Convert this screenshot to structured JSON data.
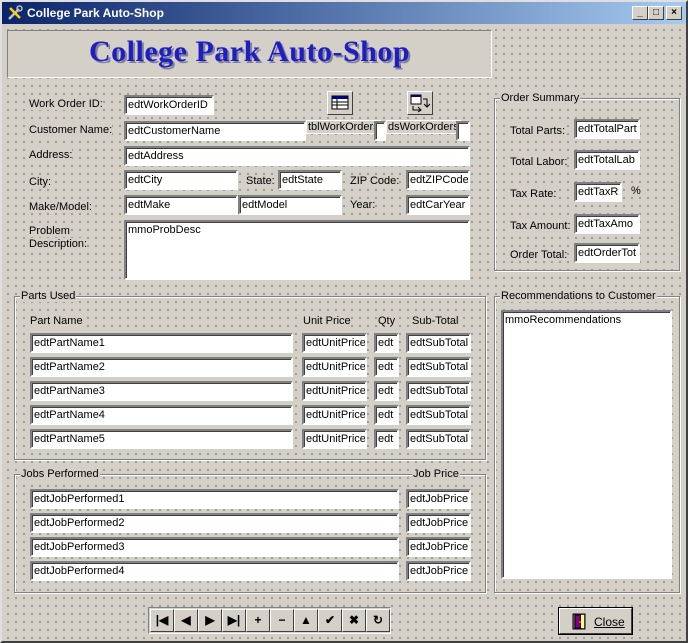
{
  "window": {
    "title": "College Park Auto-Shop",
    "min": "_",
    "max": "□",
    "close": "×"
  },
  "banner": {
    "title": "College Park Auto-Shop"
  },
  "labels": {
    "work_order_id": "Work Order ID:",
    "customer_name": "Customer Name:",
    "address": "Address:",
    "city": "City:",
    "state": "State:",
    "zip": "ZIP Code:",
    "make_model": "Make/Model:",
    "year": "Year:",
    "problem1": "Problem",
    "problem2": "Description:"
  },
  "fields": {
    "work_order_id": "edtWorkOrderID",
    "customer_name": "edtCustomerName",
    "address": "edtAddress",
    "city": "edtCity",
    "state": "edtState",
    "zip": "edtZIPCode",
    "make": "edtMake",
    "model": "edtModel",
    "year": "edtCarYear",
    "problem": "mmoProbDesc"
  },
  "components": {
    "table": "tblWorkOrders",
    "datasource": "dsWorkOrders"
  },
  "order_summary": {
    "caption": "Order Summary",
    "total_parts_label": "Total Parts:",
    "total_parts": "edtTotalPart",
    "total_labor_label": "Total Labor:",
    "total_labor": "edtTotalLab",
    "tax_rate_label": "Tax Rate:",
    "tax_rate": "edtTaxR",
    "percent": "%",
    "tax_amount_label": "Tax Amount:",
    "tax_amount": "edtTaxAmo",
    "order_total_label": "Order Total:",
    "order_total": "edtOrderTot"
  },
  "parts": {
    "caption": "Parts Used",
    "headers": {
      "name": "Part Name",
      "price": "Unit Price",
      "qty": "Qty",
      "subtotal": "Sub-Total"
    },
    "rows": [
      {
        "name": "edtPartName1",
        "price": "edtUnitPrice",
        "qty": "edt",
        "subtotal": "edtSubTotal"
      },
      {
        "name": "edtPartName2",
        "price": "edtUnitPrice",
        "qty": "edt",
        "subtotal": "edtSubTotal"
      },
      {
        "name": "edtPartName3",
        "price": "edtUnitPrice",
        "qty": "edt",
        "subtotal": "edtSubTotal"
      },
      {
        "name": "edtPartName4",
        "price": "edtUnitPrice",
        "qty": "edt",
        "subtotal": "edtSubTotal"
      },
      {
        "name": "edtPartName5",
        "price": "edtUnitPrice",
        "qty": "edt",
        "subtotal": "edtSubTotal"
      }
    ]
  },
  "jobs": {
    "caption": "Jobs Performed",
    "price_header": "Job Price",
    "rows": [
      {
        "name": "edtJobPerformed1",
        "price": "edtJobPrice"
      },
      {
        "name": "edtJobPerformed2",
        "price": "edtJobPrice"
      },
      {
        "name": "edtJobPerformed3",
        "price": "edtJobPrice"
      },
      {
        "name": "edtJobPerformed4",
        "price": "edtJobPrice"
      }
    ]
  },
  "recommendations": {
    "caption": "Recommendations to Customer",
    "memo": "mmoRecommendations"
  },
  "navigator": {
    "buttons": [
      {
        "name": "nav-first-button",
        "glyph": "|◀"
      },
      {
        "name": "nav-prior-button",
        "glyph": "◀"
      },
      {
        "name": "nav-next-button",
        "glyph": "▶"
      },
      {
        "name": "nav-last-button",
        "glyph": "▶|"
      },
      {
        "name": "nav-insert-button",
        "glyph": "+"
      },
      {
        "name": "nav-delete-button",
        "glyph": "−"
      },
      {
        "name": "nav-edit-button",
        "glyph": "▲"
      },
      {
        "name": "nav-post-button",
        "glyph": "✔"
      },
      {
        "name": "nav-cancel-button",
        "glyph": "✖"
      },
      {
        "name": "nav-refresh-button",
        "glyph": "↻"
      }
    ]
  },
  "close_button": {
    "label": "Close"
  },
  "colors": {
    "title_start": "#0a246a",
    "title_end": "#a6caf0",
    "banner_text": "#1f1fbf",
    "face": "#d4d0c8"
  }
}
